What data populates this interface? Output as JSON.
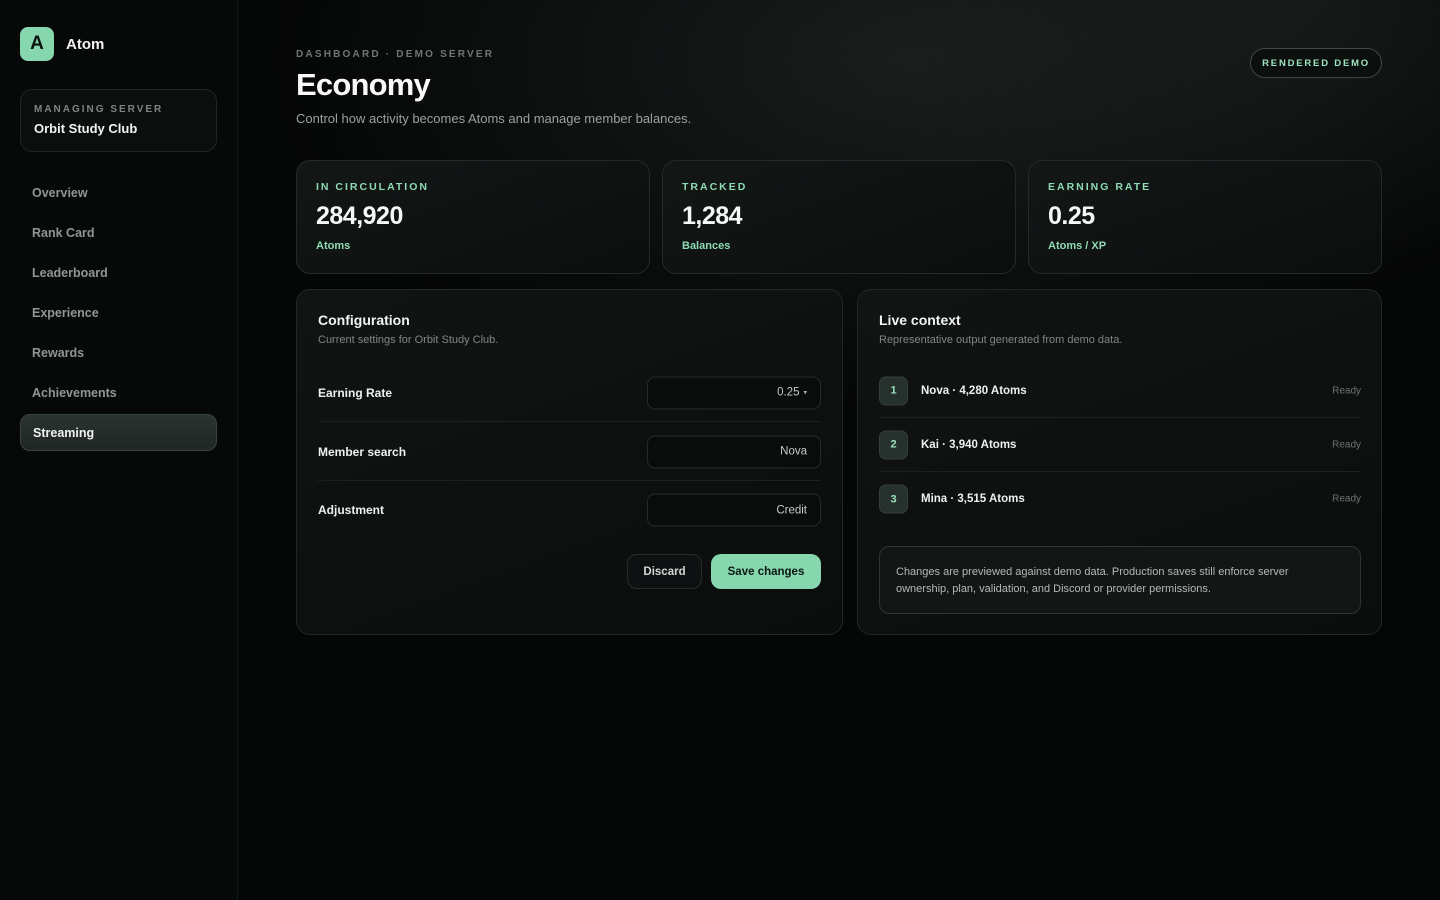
{
  "app": {
    "logo_letter": "A",
    "name": "Atom"
  },
  "server": {
    "kicker": "MANAGING SERVER",
    "name": "Orbit Study Club"
  },
  "nav": {
    "items": [
      {
        "label": "Overview"
      },
      {
        "label": "Rank Card"
      },
      {
        "label": "Leaderboard"
      },
      {
        "label": "Experience"
      },
      {
        "label": "Rewards"
      },
      {
        "label": "Achievements"
      },
      {
        "label": "Streaming",
        "active": true
      }
    ]
  },
  "header": {
    "breadcrumb": "DASHBOARD · DEMO SERVER",
    "title": "Economy",
    "subtitle": "Control how activity becomes Atoms and manage member balances.",
    "badge": "RENDERED DEMO"
  },
  "stats": [
    {
      "label": "IN CIRCULATION",
      "value": "284,920",
      "unit": "Atoms"
    },
    {
      "label": "TRACKED",
      "value": "1,284",
      "unit": "Balances"
    },
    {
      "label": "EARNING RATE",
      "value": "0.25",
      "unit": "Atoms / XP"
    }
  ],
  "config": {
    "title": "Configuration",
    "subtitle": "Current settings for Orbit Study Club.",
    "rows": [
      {
        "label": "Earning Rate",
        "value": "0.25",
        "caret": "▾"
      },
      {
        "label": "Member search",
        "value": "Nova"
      },
      {
        "label": "Adjustment",
        "value": "Credit"
      }
    ],
    "discard_label": "Discard",
    "save_label": "Save changes"
  },
  "context": {
    "title": "Live context",
    "subtitle": "Representative output generated from demo data.",
    "rows": [
      {
        "rank": "1",
        "text": "Nova · 4,280 Atoms",
        "status": "Ready"
      },
      {
        "rank": "2",
        "text": "Kai · 3,940 Atoms",
        "status": "Ready"
      },
      {
        "rank": "3",
        "text": "Mina · 3,515 Atoms",
        "status": "Ready"
      }
    ],
    "note": "Changes are previewed against demo data. Production saves still enforce server ownership, plan, validation, and Discord or provider permissions."
  },
  "colors": {
    "accent": "#86d7ad",
    "background": "#050606"
  }
}
